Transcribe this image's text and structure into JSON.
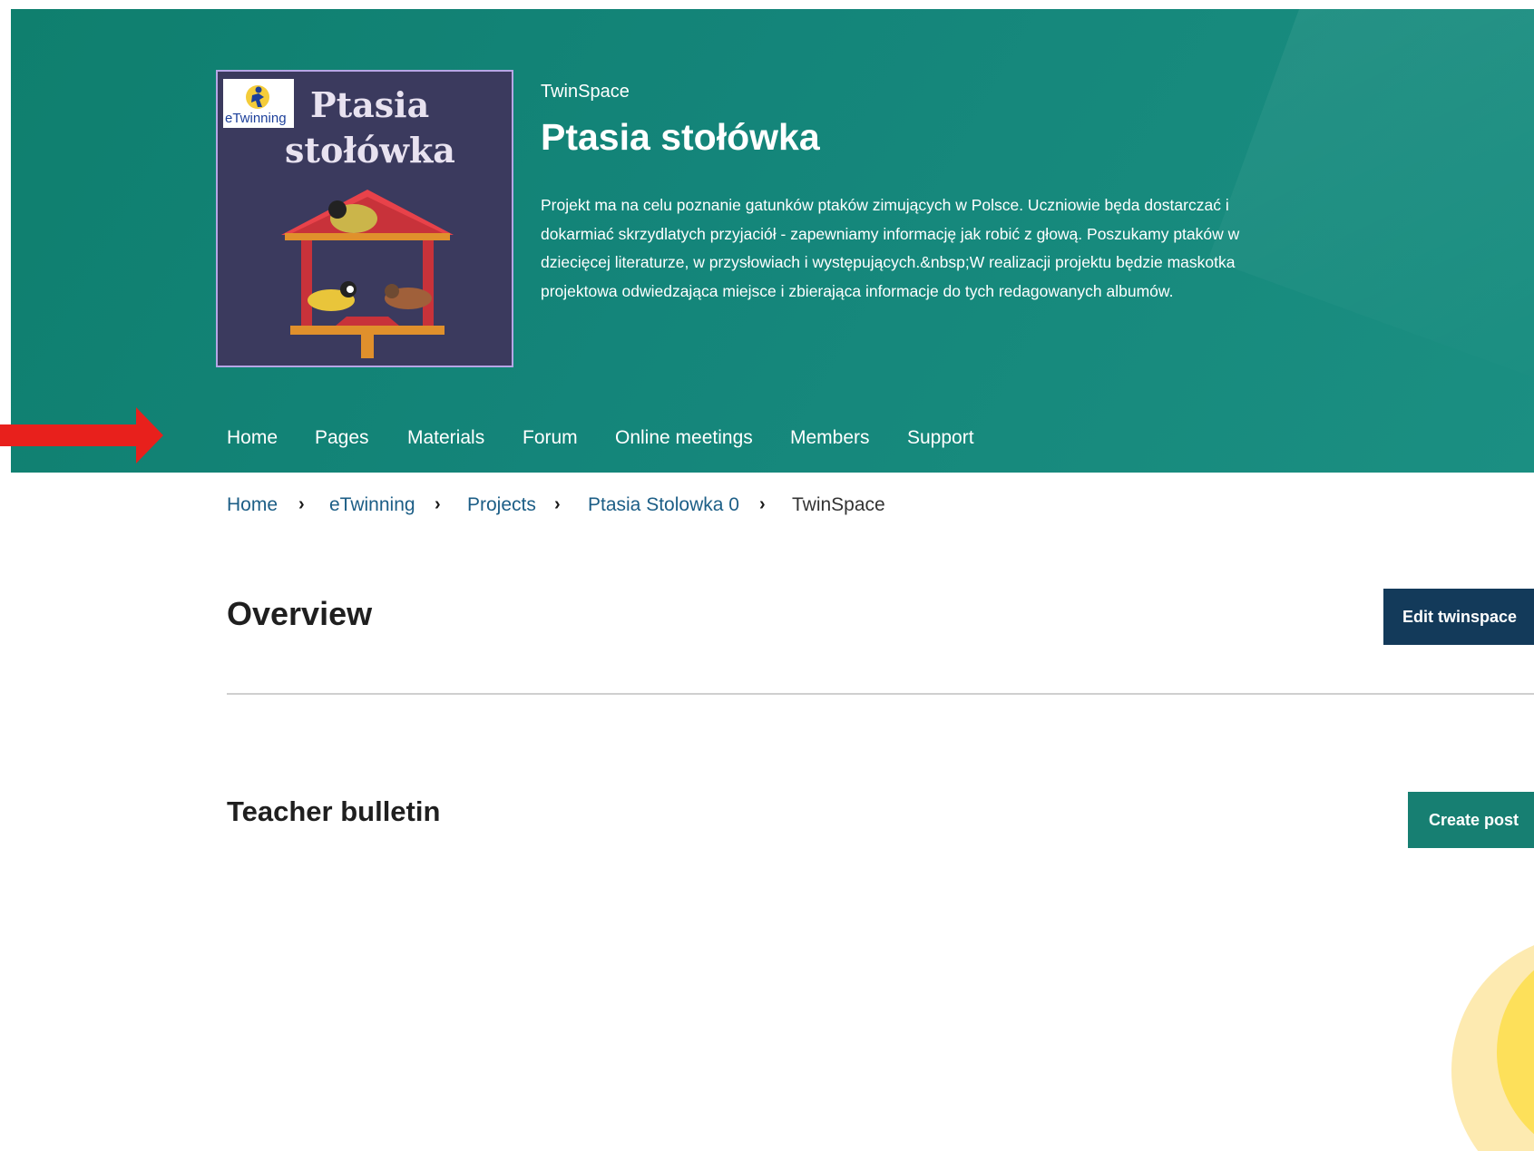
{
  "header": {
    "eyebrow": "TwinSpace",
    "title": "Ptasia stołówka",
    "description": "Projekt ma na celu poznanie gatunków ptaków zimujących w Polsce. Uczniowie będa dostarczać i dokarmiać skrzydlatych przyjaciół - zapewniamy informację jak robić z głową. Poszukamy ptaków w dziecięcej literaturze, w przysłowiach i występujących.&nbsp;W realizacji projektu będzie maskotka projektowa odwiedzająca miejsce i zbierająca informacje do tych redagowanych albumów.",
    "thumbnail": {
      "logo_text": "eTwinning",
      "title_line1": "Ptasia",
      "title_line2": "stołówka"
    }
  },
  "nav": {
    "items": [
      {
        "label": "Home",
        "active": true
      },
      {
        "label": "Pages"
      },
      {
        "label": "Materials"
      },
      {
        "label": "Forum"
      },
      {
        "label": "Online meetings"
      },
      {
        "label": "Members"
      },
      {
        "label": "Support"
      }
    ]
  },
  "breadcrumb": {
    "items": [
      "Home",
      "eTwinning",
      "Projects",
      "Ptasia Stolowka 0",
      "TwinSpace"
    ],
    "separator": "›"
  },
  "overview": {
    "heading": "Overview",
    "edit_button": "Edit twinspace"
  },
  "bulletin": {
    "heading": "Teacher bulletin",
    "create_button": "Create post"
  },
  "colors": {
    "hero": "#14857a",
    "edit_button": "#133a5a",
    "create_button": "#177f72",
    "annotation_arrow": "#e8201c",
    "link": "#1c5e86"
  },
  "icons": {
    "breadcrumb_separator": "chevron-right-icon",
    "annotation": "red-arrow-icon"
  }
}
